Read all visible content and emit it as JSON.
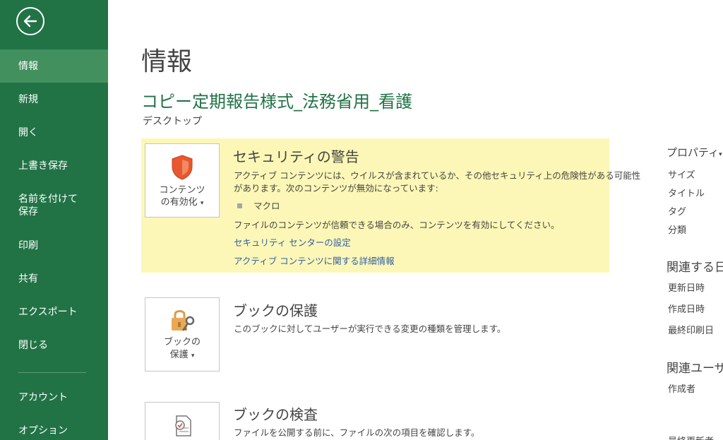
{
  "sidebar": {
    "items": [
      {
        "label": "情報"
      },
      {
        "label": "新規"
      },
      {
        "label": "開く"
      },
      {
        "label": "上書き保存"
      },
      {
        "label": "名前を付けて"
      },
      {
        "label": "保存"
      },
      {
        "label": "印刷"
      },
      {
        "label": "共有"
      },
      {
        "label": "エクスポート"
      },
      {
        "label": "閉じる"
      },
      {
        "label": "アカウント"
      },
      {
        "label": "オプション"
      }
    ]
  },
  "page": {
    "title": "情報",
    "doc_name": "コピー定期報告様式_法務省用_看護",
    "location": "デスクトップ"
  },
  "security": {
    "button_line1": "コンテンツ",
    "button_line2": "の有効化",
    "button_arrow": "▾",
    "title": "セキュリティの警告",
    "desc_line1": "アクティブ コンテンツには、ウイルスが含まれているか、その他セキュリティ上の危険性がある可能性",
    "desc_line2": "があります。次のコンテンツが無効になっています:",
    "item": "マクロ",
    "note": "ファイルのコンテンツが信頼できる場合のみ、コンテンツを有効にしてください。",
    "link1": "セキュリティ センターの設定",
    "link2": "アクティブ コンテンツに関する詳細情報"
  },
  "protect": {
    "button_line1": "ブックの",
    "button_line2": "保護",
    "button_arrow": "▾",
    "title": "ブックの保護",
    "desc": "このブックに対してユーザーが実行できる変更の種類を管理します。"
  },
  "inspect": {
    "title": "ブックの検査",
    "desc": "ファイルを公開する前に、ファイルの次の項目を確認します。"
  },
  "properties": {
    "header": "プロパティ",
    "header_arrow": "▾",
    "fields": [
      "サイズ",
      "タイトル",
      "タグ",
      "分類"
    ],
    "dates_header": "関連する日",
    "dates": [
      "更新日時",
      "作成日時",
      "最終印刷日"
    ],
    "users_header": "関連ユーザー",
    "users": [
      "作成者"
    ],
    "last_cut": "最終更新者"
  },
  "colors": {
    "sidebar": "#217346",
    "sidebar_active": "#43905f",
    "accent": "#217346",
    "warning_bg": "#fcf7b6",
    "link": "#2e5fa8"
  },
  "icons": {
    "back": "back-arrow-icon",
    "shield": "shield-icon",
    "lock": "lock-key-icon",
    "inspect": "document-check-icon"
  }
}
